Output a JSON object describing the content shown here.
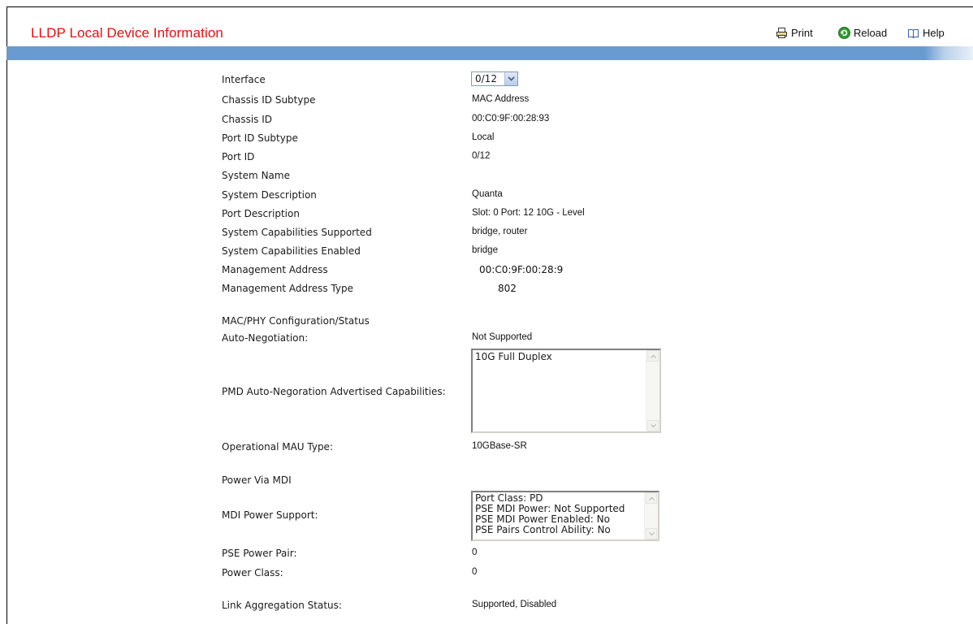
{
  "header": {
    "title": "LLDP Local Device Information",
    "actions": {
      "print": "Print",
      "reload": "Reload",
      "help": "Help"
    }
  },
  "interface": {
    "label": "Interface",
    "selected": "0/12"
  },
  "fields": {
    "chassis_id_subtype": {
      "label": "Chassis ID Subtype",
      "value": "MAC Address"
    },
    "chassis_id": {
      "label": "Chassis ID",
      "value": "00:C0:9F:00:28:93"
    },
    "port_id_subtype": {
      "label": "Port ID Subtype",
      "value": "Local"
    },
    "port_id": {
      "label": "Port ID",
      "value": "0/12"
    },
    "system_name": {
      "label": "System Name",
      "value": ""
    },
    "system_description": {
      "label": "System Description",
      "value": "Quanta"
    },
    "port_description": {
      "label": "Port Description",
      "value": "Slot: 0 Port: 12 10G - Level"
    },
    "sys_cap_supported": {
      "label": "System Capabilities Supported",
      "value": "bridge, router"
    },
    "sys_cap_enabled": {
      "label": "System Capabilities Enabled",
      "value": "bridge"
    },
    "mgmt_address": {
      "label": "Management Address",
      "value": "00:C0:9F:00:28:9"
    },
    "mgmt_address_type": {
      "label": "Management Address Type",
      "value": "802"
    }
  },
  "macphy": {
    "section_label": "MAC/PHY Configuration/Status",
    "auto_neg": {
      "label": "Auto-Negotiation:",
      "value": "Not Supported"
    },
    "pmd": {
      "label": "PMD Auto-Negoration Advertised Capabilities:",
      "items": [
        "10G Full Duplex"
      ]
    },
    "mau": {
      "label": "Operational MAU Type:",
      "value": "10GBase-SR"
    }
  },
  "power": {
    "section_label": "Power Via MDI",
    "mdi_support": {
      "label": "MDI Power Support:",
      "items": [
        "Port Class: PD",
        "PSE MDI Power: Not Supported",
        "PSE MDI Power Enabled: No",
        "PSE Pairs Control Ability: No"
      ]
    },
    "pse_pair": {
      "label": "PSE Power Pair:",
      "value": "0"
    },
    "power_class": {
      "label": "Power Class:",
      "value": "0"
    }
  },
  "link_agg": {
    "label": "Link Aggregation Status:",
    "value": "Supported, Disabled"
  },
  "colors": {
    "title_red": "#e01010",
    "header_bar_blue": "#6a9bd0",
    "reload_green": "#2e9a2e"
  },
  "icons": {
    "print": "printer-icon",
    "reload": "reload-icon",
    "help": "help-book-icon",
    "dropdown": "chevron-down-icon"
  }
}
